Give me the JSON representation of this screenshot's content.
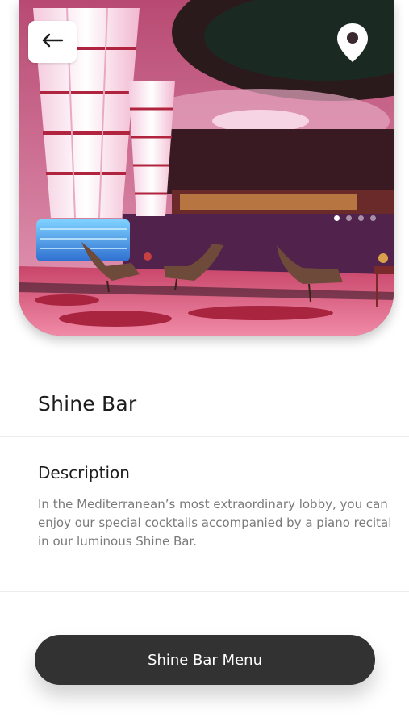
{
  "header": {
    "back_icon": "arrow-left-icon",
    "location_icon": "map-pin-icon",
    "carousel": {
      "total": 4,
      "active_index": 0
    }
  },
  "venue": {
    "title": "Shine Bar"
  },
  "description": {
    "heading": "Description",
    "body": "In the Mediterranean’s most extraordinary lobby, you can enjoy our special cocktails accompanied by a piano recital in our luminous Shine Bar."
  },
  "actions": {
    "menu_button_label": "Shine Bar Menu"
  },
  "colors": {
    "button_bg": "#323232",
    "text_primary": "#1c1c1c",
    "text_secondary": "#7a7a7a",
    "divider": "#ececec"
  }
}
